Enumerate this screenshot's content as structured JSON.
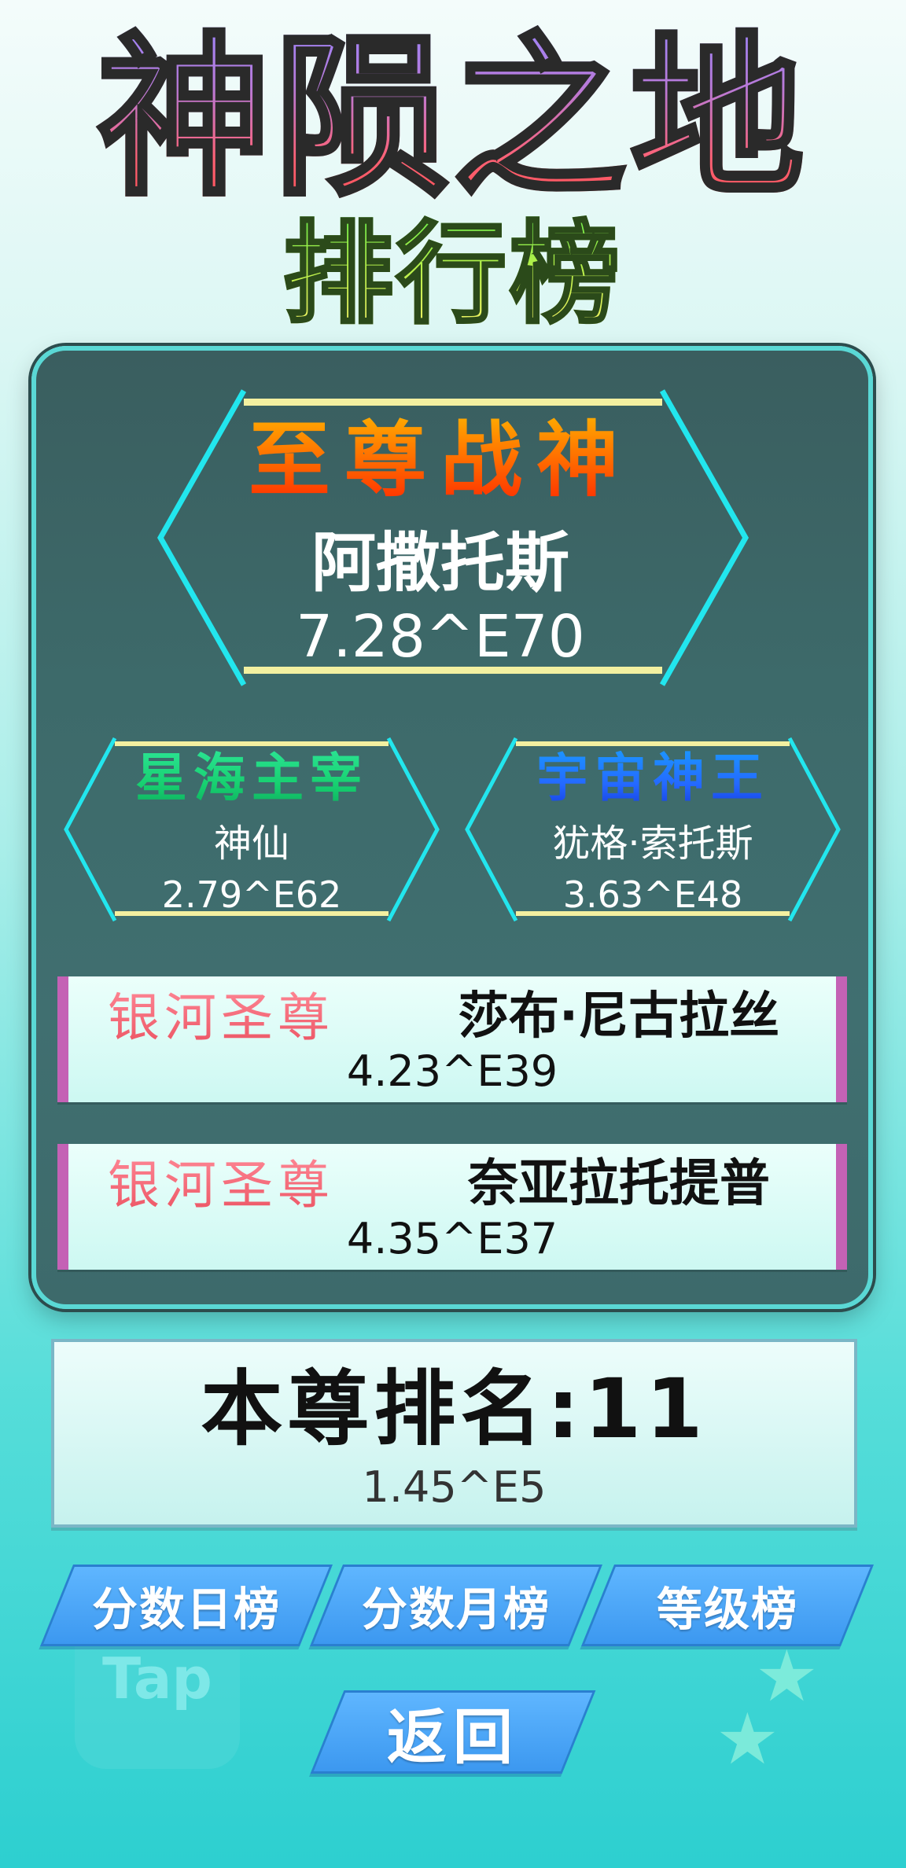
{
  "header": {
    "game_title": "神陨之地",
    "page_title": "排行榜"
  },
  "podium": {
    "first": {
      "rank_title": "至尊战神",
      "player": "阿撒托斯",
      "score": "7.28^E70"
    },
    "second": {
      "rank_title": "星海主宰",
      "player": "神仙",
      "score": "2.79^E62"
    },
    "third": {
      "rank_title": "宇宙神王",
      "player": "犹格·索托斯",
      "score": "3.63^E48"
    }
  },
  "rows": [
    {
      "rank_title": "银河圣尊",
      "player": "莎布·尼古拉丝",
      "score": "4.23^E39"
    },
    {
      "rank_title": "银河圣尊",
      "player": "奈亚拉托提普",
      "score": "4.35^E37"
    }
  ],
  "my_rank": {
    "label": "本尊排名:11",
    "score": "1.45^E5"
  },
  "buttons": {
    "daily": "分数日榜",
    "monthly": "分数月榜",
    "level": "等级榜",
    "back": "返回"
  },
  "decorations": {
    "tap_badge": "Tap"
  },
  "colors": {
    "panel": "#3d6a6a",
    "panel_border": "#5ad8d5",
    "hex_stroke": "#22e6ee",
    "hex_bar": "#f3f0a0",
    "row_accent": "#c462b5",
    "button": "#4aa6f6"
  }
}
